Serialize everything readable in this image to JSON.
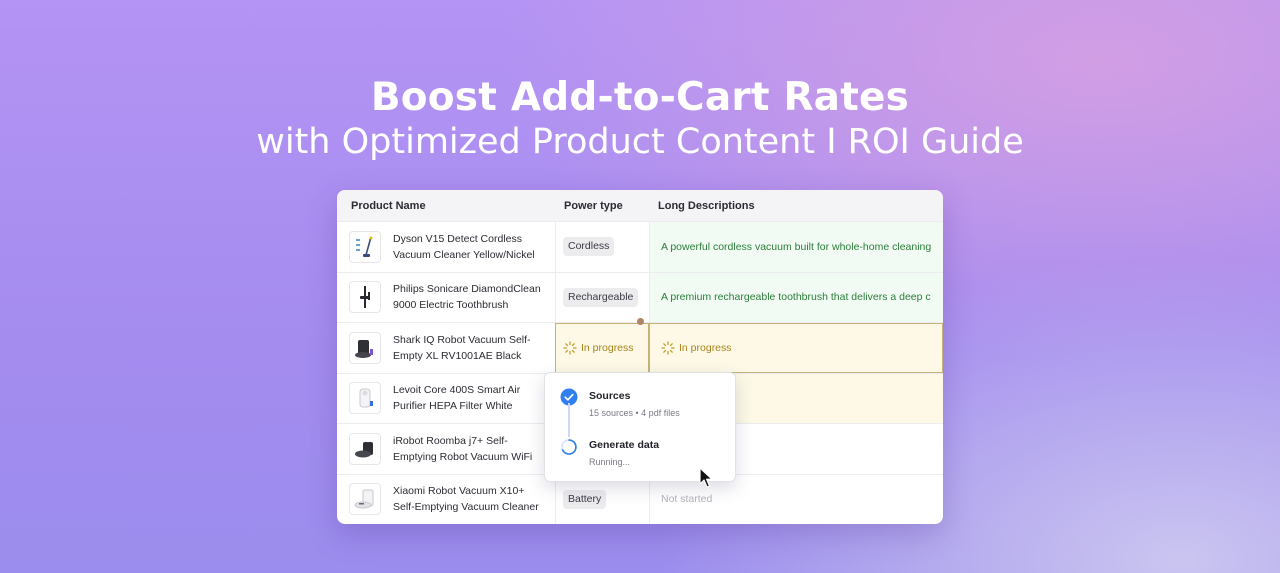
{
  "hero": {
    "title": "Boost Add-to-Cart Rates",
    "subtitle": "with Optimized Product Content I ROI Guide"
  },
  "table": {
    "columns": [
      "Product Name",
      "Power type",
      "Long Descriptions"
    ],
    "rows": [
      {
        "name": "Dyson V15 Detect Cordless Vacuum Cleaner Yellow/Nickel",
        "power": "Cordless",
        "description": "A powerful cordless vacuum built for whole-home cleaning"
      },
      {
        "name": "Philips Sonicare DiamondClean 9000 Electric Toothbrush",
        "power": "Rechargeable",
        "description": "A premium rechargeable toothbrush that delivers a deep c"
      },
      {
        "name": "Shark IQ Robot Vacuum Self-Empty XL RV1001AE Black",
        "power": "In progress",
        "description": "In progress"
      },
      {
        "name": "Levoit Core 400S Smart Air Purifier HEPA Filter White",
        "power": "",
        "description": ""
      },
      {
        "name": "iRobot Roomba j7+ Self-Emptying Robot Vacuum WiFi",
        "power": "",
        "description": ""
      },
      {
        "name": "Xiaomi Robot Vacuum X10+ Self-Emptying Vacuum Cleaner",
        "power": "Battery",
        "description": "Not started"
      }
    ]
  },
  "popover": {
    "steps": [
      {
        "title": "Sources",
        "subtitle": "15 sources • 4 pdf files",
        "status": "done"
      },
      {
        "title": "Generate data",
        "subtitle": "Running...",
        "status": "running"
      }
    ]
  },
  "colors": {
    "accent_blue": "#2f7ff0",
    "progress_text": "#a8841a",
    "description_green": "#2e7d3a"
  },
  "icons": {
    "rows": [
      "stick-vacuum-icon",
      "toothbrush-icon",
      "robot-vacuum-icon",
      "air-purifier-icon",
      "robot-vacuum-dock-icon",
      "robot-vacuum-station-icon"
    ],
    "popover": [
      "check-circle-icon",
      "spinner-icon",
      "mouse-cursor-icon"
    ]
  }
}
